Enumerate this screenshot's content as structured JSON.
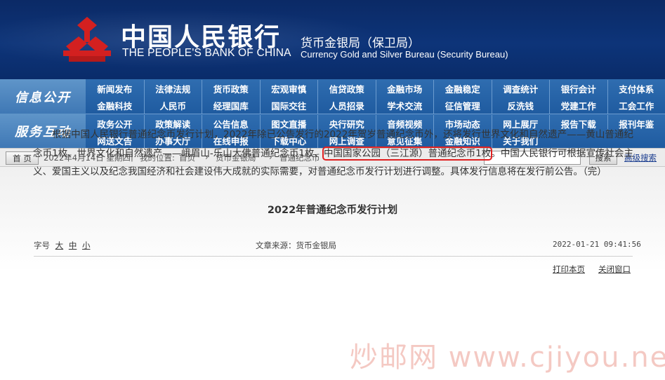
{
  "header": {
    "bank_cn": "中国人民银行",
    "bank_en": "THE PEOPLE'S BANK OF CHINA",
    "bureau_cn": "货币金银局（保卫局）",
    "bureau_en": "Currency Gold and Silver Bureau (Security Bureau)",
    "brand_color": "#0d3479",
    "emblem_color": "#d32020"
  },
  "nav": {
    "section1_label": "信息公开",
    "section2_label": "服务互动",
    "row1": [
      "新闻发布",
      "法律法规",
      "货币政策",
      "宏观审慎",
      "信贷政策",
      "金融市场",
      "金融稳定",
      "调查统计",
      "银行会计",
      "支付体系"
    ],
    "row2": [
      "金融科技",
      "人民币",
      "经理国库",
      "国际交往",
      "人员招录",
      "学术交流",
      "征信管理",
      "反洗钱",
      "党建工作",
      "工会工作"
    ],
    "row3": [
      "政务公开",
      "政策解读",
      "公告信息",
      "图文直播",
      "央行研究",
      "音频视频",
      "市场动态",
      "网上展厅",
      "报告下载",
      "报刊年鉴"
    ],
    "row4": [
      "网送文告",
      "办事大厅",
      "在线申报",
      "下载中心",
      "网上调查",
      "意见征集",
      "金融知识",
      "关于我们"
    ]
  },
  "crumbbar": {
    "home_button": "首 页",
    "date": "2022年4月14日 星期四",
    "location_label": "我的位置:",
    "crumb_home": "首页",
    "crumb_sep": "›",
    "crumb_bureau": "货币金银局",
    "crumb_current": "普通纪念币",
    "search_button": "搜索",
    "advanced_search": "高级搜索",
    "search_value": ""
  },
  "article": {
    "title": "2022年普通纪念币发行计划",
    "font_size_label": "字号",
    "font_large": "大",
    "font_medium": "中",
    "font_small": "小",
    "source": "文章来源：货币金银局",
    "datetime": "2022-01-21  09:41:56",
    "print_link": "打印本页",
    "close_link": "关闭窗口",
    "body_before": "根据中国人民银行普通纪念币发行计划，2022年除已公告发行的2022年贺岁普通纪念币外，还将发行世界文化和自然遗产——黄山普通纪念币1枚、世界文化和自然遗产——峨眉山-乐山大佛普通纪念币1枚、",
    "body_highlight": "中国国家公园（三江源）普通纪念币1枚",
    "body_after": "。中国人民银行可根据宣传社会主义、爱国主义以及纪念我国经济和社会建设伟大成就的实际需要，对普通纪念币发行计划进行调整。具体发行信息将在发行前公告。（完）"
  },
  "watermark": {
    "text": "炒邮网 www.cjiyou.net"
  }
}
